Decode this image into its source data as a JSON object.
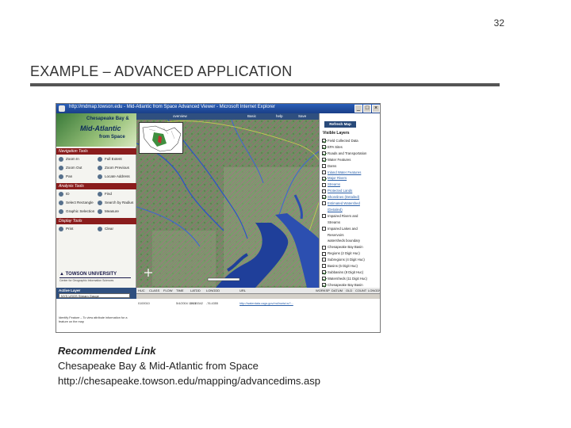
{
  "page_number": "32",
  "title": "EXAMPLE – ADVANCED APPLICATION",
  "screenshot": {
    "window_title": "http://mdmap.towson.edu - Mid-Atlantic from Space Advanced Viewer - Microsoft Internet Explorer",
    "window_buttons": {
      "minimize": "_",
      "maximize": "□",
      "close": "×"
    },
    "logo": {
      "line1": "Chesapeake Bay &",
      "line2": "Mid-Atlantic",
      "line3": "from Space"
    },
    "tabs": {
      "overview": "overview",
      "basic": "Basic",
      "help": "help",
      "save": "Save Request",
      "print": "Print Map"
    },
    "navigation_tools": {
      "heading": "Navigation Tools",
      "items": [
        "Zoom In",
        "Full Extent",
        "Zoom Out",
        "Zoom Previous",
        "Pan",
        "Locate Address"
      ]
    },
    "analysis_tools": {
      "heading": "Analysis Tools",
      "items": [
        "ID",
        "Find",
        "Select Rectangle",
        "Search by Radius",
        "Graphic Selection",
        "Measure"
      ]
    },
    "display_tools": {
      "heading": "Display Tools",
      "items": [
        "Print",
        "Clear"
      ]
    },
    "university": {
      "name": "TOWSON UNIVERSITY",
      "sub": "Center for Geographic Information Sciences"
    },
    "layers_panel": {
      "refresh_label": "Refresh Map",
      "heading": "Visible Layers",
      "items": [
        {
          "label": "Field Collected Data",
          "checked": true,
          "link": false
        },
        {
          "label": "EPA Sites",
          "checked": true,
          "link": false
        },
        {
          "label": "Roads and Transportation",
          "checked": true,
          "link": false
        },
        {
          "label": "Water Features",
          "checked": true,
          "link": false
        },
        {
          "label": "Dams",
          "checked": false,
          "link": false
        },
        {
          "label": "Inland Water Features",
          "checked": false,
          "link": true
        },
        {
          "label": "Major Rivers",
          "checked": true,
          "link": true
        },
        {
          "label": "Streams",
          "checked": false,
          "link": true
        },
        {
          "label": "Protected Lands",
          "checked": false,
          "link": true
        },
        {
          "label": "Shorelines (Detailed)",
          "checked": true,
          "link": true
        },
        {
          "label": "Estimated Watershed",
          "checked": false,
          "link": true
        },
        {
          "label": "(Detailed)",
          "checked": null,
          "link": true
        },
        {
          "label": "Impaired Rivers and",
          "checked": false,
          "link": false
        },
        {
          "label": "Streams",
          "checked": null,
          "link": false
        },
        {
          "label": "Impaired Lakes and",
          "checked": false,
          "link": false
        },
        {
          "label": "Reservoirs",
          "checked": null,
          "link": false
        },
        {
          "label": "watersheds boundary",
          "checked": null,
          "link": false
        },
        {
          "label": "Chesapeake Bay Basin",
          "checked": false,
          "link": false
        },
        {
          "label": "Regions (2 Digit Huc)",
          "checked": false,
          "link": false
        },
        {
          "label": "Subregions (4 Digit Huc)",
          "checked": false,
          "link": false
        },
        {
          "label": "Basins (6 Digit Huc)",
          "checked": false,
          "link": false
        },
        {
          "label": "Subbasins (8 Digit Huc)",
          "checked": true,
          "link": false
        },
        {
          "label": "Watersheds (11 Digit Huc)",
          "checked": true,
          "link": false
        },
        {
          "label": "Chesapeake Bay Basin",
          "checked": true,
          "link": false
        }
      ]
    },
    "active_layer": {
      "label": "Active Layer",
      "value": "NYS USGS Stream Gauge"
    },
    "grid": {
      "headers": [
        "HUC",
        "CLASS",
        "FLOW",
        "TIME",
        "LATDD",
        "LONGDD",
        "URL",
        "WORKSP",
        "DATUM",
        "OLD",
        "COUNT",
        "LONGDWF"
      ],
      "row": [
        "0100010",
        "",
        "",
        "5/4/2004 11:15",
        "39.15342",
        "-76.4355",
        "http://waterdata.usgs.gov/md/nwis/uv?...",
        "",
        "",
        "",
        "",
        ""
      ]
    },
    "identify_note": "Identify Feature – To view attribute information for a feature on the map"
  },
  "caption": {
    "heading": "Recommended Link",
    "line1": "Chesapeake Bay & Mid-Atlantic from Space",
    "line2": "http://chesapeake.towson.edu/mapping/advancedims.asp"
  },
  "colors": {
    "title_rule": "#555555",
    "nav_header": "#8a1c1c",
    "map_water": "#1f3f9a"
  }
}
